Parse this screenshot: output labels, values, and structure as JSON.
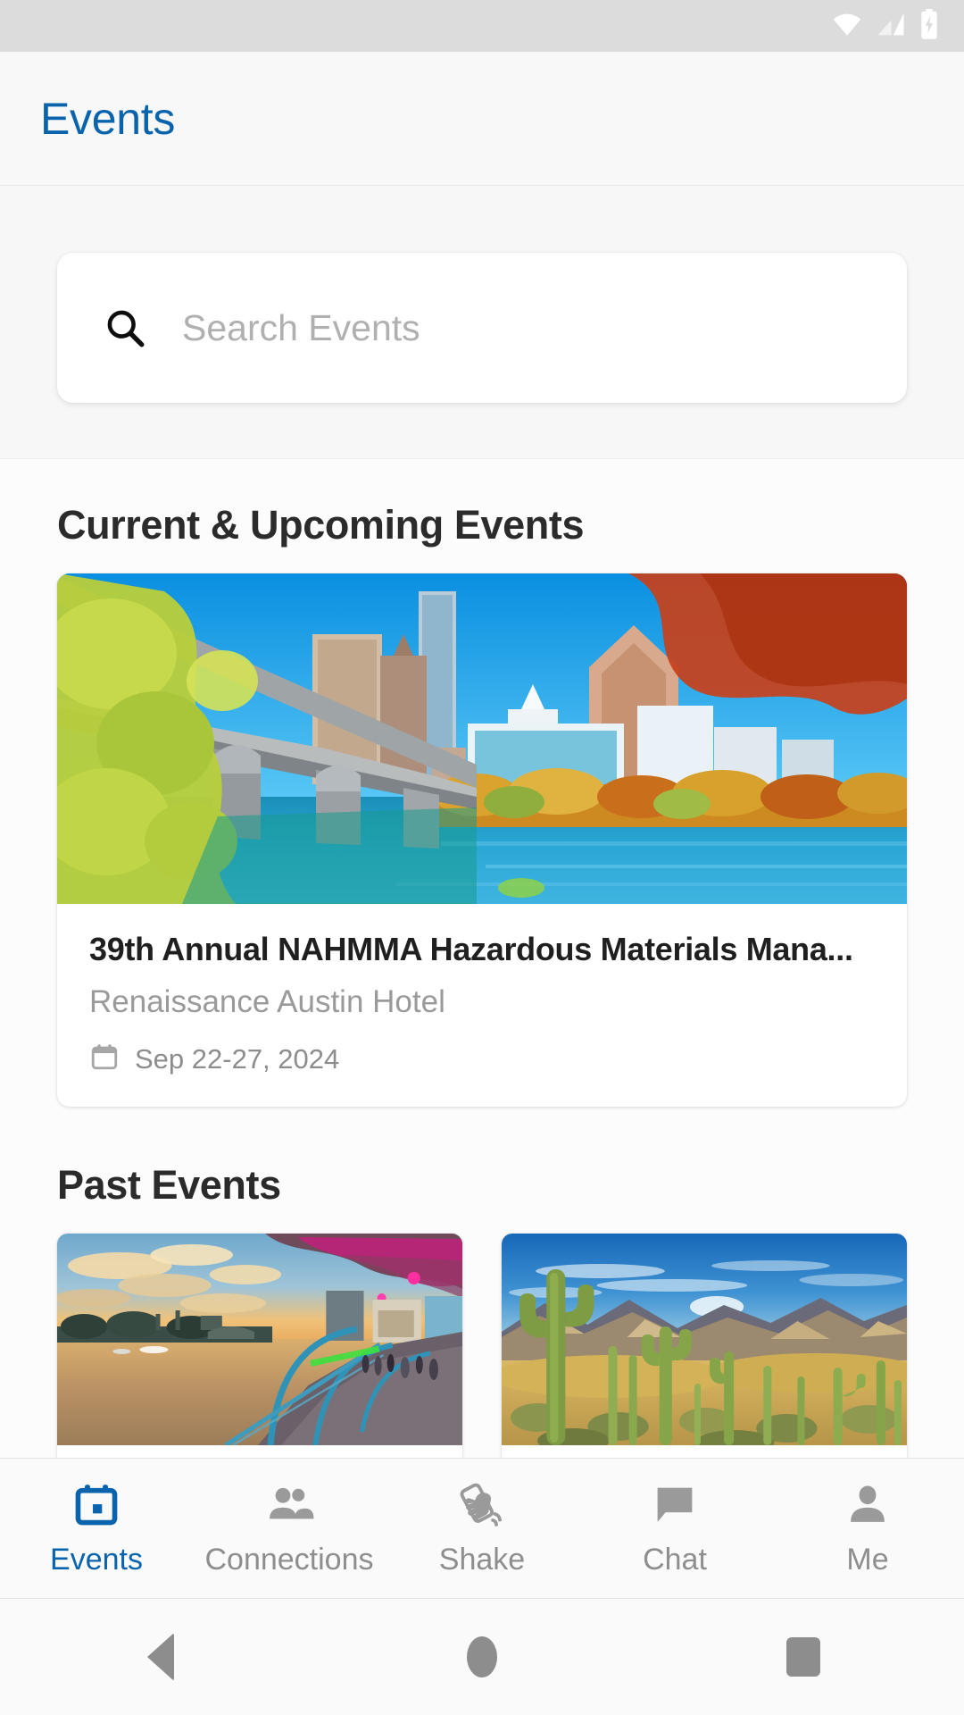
{
  "status_bar": {
    "icons": [
      "wifi-icon",
      "cellular-signal-icon",
      "battery-charging-icon"
    ]
  },
  "app_bar": {
    "title": "Events",
    "title_color": "#0a64ad"
  },
  "search": {
    "icon": "search-icon",
    "placeholder": "Search Events",
    "value": ""
  },
  "sections": {
    "upcoming_title": "Current & Upcoming Events",
    "past_title": "Past Events"
  },
  "upcoming_events": [
    {
      "title": "39th Annual NAHMMA Hazardous Materials Mana...",
      "venue": "Renaissance Austin Hotel",
      "date": "Sep 22-27, 2024",
      "date_icon": "calendar-icon",
      "image_alt": "austin-skyline-bridge-lady-bird-lake"
    }
  ],
  "past_events": [
    {
      "image_alt": "tampa-riverwalk-sunset"
    },
    {
      "image_alt": "saguaro-cactus-desert-mountains"
    }
  ],
  "bottom_nav": {
    "active_index": 0,
    "active_color": "#0a64ad",
    "inactive_color": "#8e8e8e",
    "items": [
      {
        "label": "Events",
        "icon": "calendar-icon"
      },
      {
        "label": "Connections",
        "icon": "people-icon"
      },
      {
        "label": "Shake",
        "icon": "shake-phone-icon"
      },
      {
        "label": "Chat",
        "icon": "chat-bubble-icon"
      },
      {
        "label": "Me",
        "icon": "person-icon"
      }
    ]
  },
  "system_nav": {
    "buttons": [
      "back-button",
      "home-button",
      "recents-button"
    ]
  }
}
